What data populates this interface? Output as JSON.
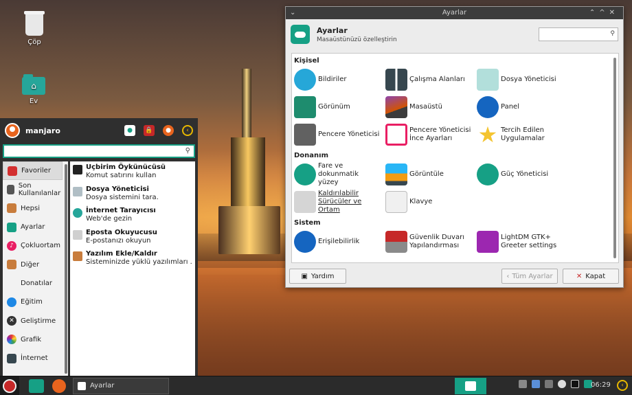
{
  "desktop": {
    "icons": [
      {
        "label": "Çöp"
      },
      {
        "label": "Ev"
      }
    ]
  },
  "menu": {
    "username": "manjaro",
    "search_value": "",
    "categories": [
      {
        "label": "Favoriler",
        "icon": "bookmark-icon",
        "color": "#d32f2f"
      },
      {
        "label": "Son Kullanılanlar",
        "icon": "recent-icon",
        "color": "#555555"
      },
      {
        "label": "Hepsi",
        "icon": "all-apps-icon",
        "color": "#c87c3c"
      },
      {
        "label": "Ayarlar",
        "icon": "settings-toggle-icon",
        "color": "#16a085"
      },
      {
        "label": "Çokluortam",
        "icon": "music-icon",
        "color": "#e91e63"
      },
      {
        "label": "Diğer",
        "icon": "other-icon",
        "color": "#c87c3c"
      },
      {
        "label": "Donatılar",
        "icon": "accessories-icon",
        "color": "#f2f2f2"
      },
      {
        "label": "Eğitim",
        "icon": "education-icon",
        "color": "#1e88e5"
      },
      {
        "label": "Geliştirme",
        "icon": "development-icon",
        "color": "#333333"
      },
      {
        "label": "Grafik",
        "icon": "graphics-icon",
        "color": "#e53935"
      },
      {
        "label": "İnternet",
        "icon": "internet-icon",
        "color": "#37474f"
      }
    ],
    "apps": [
      {
        "title": "Uçbirim Öykünücüsü",
        "desc": "Komut satırını kullan",
        "icon": "terminal-icon",
        "color": "#222222"
      },
      {
        "title": "Dosya Yöneticisi",
        "desc": "Dosya sistemini tara.",
        "icon": "folder-icon",
        "color": "#b0bec5"
      },
      {
        "title": "İnternet Tarayıcısı",
        "desc": "Web'de gezin",
        "icon": "globe-icon",
        "color": "#26a69a"
      },
      {
        "title": "Eposta Okuyucusu",
        "desc": "E-postanızı okuyun",
        "icon": "mail-icon",
        "color": "#cfcfcf"
      },
      {
        "title": "Yazılım Ekle/Kaldır",
        "desc": "Sisteminizde yüklü yazılımları ...",
        "icon": "package-icon",
        "color": "#c87c3c"
      }
    ]
  },
  "settings": {
    "window_title": "Ayarlar",
    "header_title": "Ayarlar",
    "header_subtitle": "Masaüstünüzü özelleştirin",
    "search_value": "",
    "sections": [
      {
        "title": "Kişisel",
        "items": [
          {
            "label": "Bildiriler",
            "icon": "notifications-icon",
            "color": "#26a7d8"
          },
          {
            "label": "Çalışma Alanları",
            "icon": "workspaces-icon",
            "color": "#37474f"
          },
          {
            "label": "Dosya Yöneticisi",
            "icon": "file-manager-icon",
            "color": "#b2dfdb"
          },
          {
            "label": "Görünüm",
            "icon": "appearance-icon",
            "color": "#1e8c6e"
          },
          {
            "label": "Masaüstü",
            "icon": "desktop-icon",
            "color": "#d35400"
          },
          {
            "label": "Panel",
            "icon": "panel-icon",
            "color": "#1565c0"
          },
          {
            "label": "Pencere Yöneticisi",
            "icon": "window-manager-icon",
            "color": "#616161"
          },
          {
            "label": "Pencere Yöneticisi İnce Ayarları",
            "icon": "wm-tweaks-icon",
            "color": "#e91e63"
          },
          {
            "label": "Tercih Edilen Uygulamalar",
            "icon": "preferred-apps-icon",
            "color": "#f4c430"
          }
        ]
      },
      {
        "title": "Donanım",
        "items": [
          {
            "label": "Fare ve dokunmatik yüzey",
            "icon": "mouse-icon",
            "color": "#16a085"
          },
          {
            "label": "Görüntüle",
            "icon": "display-icon",
            "color": "#f39c12"
          },
          {
            "label": "Güç Yöneticisi",
            "icon": "power-icon",
            "color": "#16a085"
          },
          {
            "label": "Kaldırılabilir Sürücüler ve Ortam",
            "icon": "removable-drives-icon",
            "color": "#d5d5d5"
          },
          {
            "label": "Klavye",
            "icon": "keyboard-icon",
            "color": "#e0e0e0"
          }
        ]
      },
      {
        "title": "Sistem",
        "items": [
          {
            "label": "Erişilebilirlik",
            "icon": "accessibility-icon",
            "color": "#1565c0"
          },
          {
            "label": "Güvenlik Duvarı Yapılandırması",
            "icon": "firewall-icon",
            "color": "#c62828"
          },
          {
            "label": "LightDM GTK+ Greeter settings",
            "icon": "lightdm-icon",
            "color": "#9c27b0"
          }
        ]
      }
    ],
    "buttons": {
      "help": "Yardım",
      "all": "Tüm Ayarlar",
      "close": "Kapat"
    }
  },
  "taskbar": {
    "task_label": "Ayarlar",
    "clock": "06:29"
  }
}
